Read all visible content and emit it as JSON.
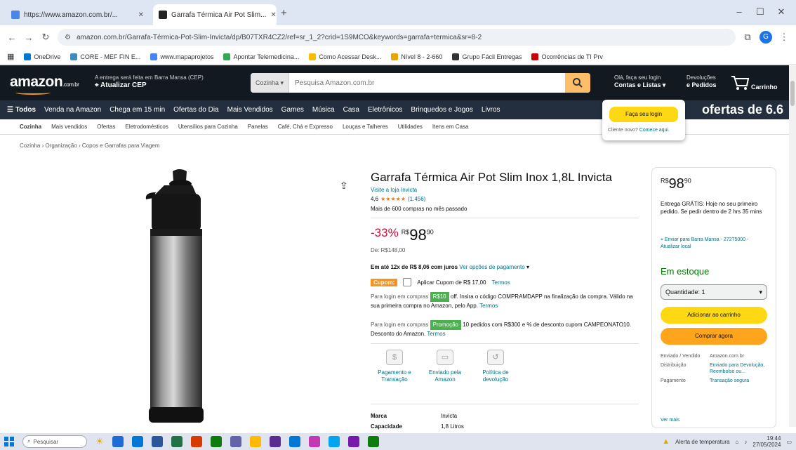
{
  "browser": {
    "tabs": [
      {
        "title": "https://www.amazon.com.br/...",
        "fav": "#4a86e8"
      },
      {
        "title": "Garrafa Térmica Air Pot Slim...",
        "fav": "#222"
      }
    ],
    "new_tab": "+",
    "url": "amazon.com.br/Garrafa-Térmica-Pot-Slim-Invicta/dp/B07TXR4CZ2/ref=sr_1_2?crid=1S9MCO&keywords=garrafa+termica&sr=8-2",
    "bookmarks": [
      {
        "label": "OneDrive",
        "color": "#0078d4"
      },
      {
        "label": "CORE - MEF FIN E...",
        "color": "#3c8dbc"
      },
      {
        "label": "www.mapaprojetos",
        "color": "#4285f4"
      },
      {
        "label": "Apontar Telemedicina...",
        "color": "#34a853"
      },
      {
        "label": "Como Acessar Desk...",
        "color": "#fbbc04"
      },
      {
        "label": "Nível 8 - 2-660",
        "color": "#e6a700"
      },
      {
        "label": "Grupo Fácil Entregas",
        "color": "#333"
      },
      {
        "label": "Ocorrências de TI Prv",
        "color": "#cc0000"
      }
    ]
  },
  "amazon": {
    "logo": "amazon",
    "logo_suffix": ".com.br",
    "location_line1": "A entrega será feita em Barra Mansa (CEP)",
    "location_line2": "Atualizar CEP",
    "search_category": "Cozinha",
    "search_placeholder": "Pesquisa Amazon.com.br",
    "account_line1": "Olá, faça seu login",
    "account_line2": "Contas e Listas",
    "orders_line1": "Devoluções",
    "orders_line2": "e Pedidos",
    "cart_label": "Carrinho",
    "nav": [
      "Todos",
      "Venda na Amazon",
      "Chega em 15 min",
      "Ofertas do Dia",
      "Mais Vendidos",
      "Games",
      "Música",
      "Casa",
      "Eletrônicos",
      "Brinquedos e Jogos",
      "Livros"
    ],
    "promo": "ofertas de 6.6",
    "subnav": [
      "Cozinha",
      "Mais vendidos",
      "Ofertas",
      "Eletrodomésticos",
      "Utensílios para Cozinha",
      "Panelas",
      "Café, Chá e Expresso",
      "Louças e Talheres",
      "Utilidades",
      "Itens em Casa"
    ],
    "breadcrumb": "Cozinha › Organização › Copos e Garrafas para Viagem",
    "popup": {
      "button": "Faça seu login",
      "new_customer": "Cliente novo?",
      "start_here": "Comece aqui."
    }
  },
  "product": {
    "title": "Garrafa Térmica Air Pot Slim Inox 1,8L Invicta",
    "store": "Visite a loja Invicta",
    "rating": "4,6",
    "stars": "★★★★★",
    "reviews": "(1.456)",
    "bought": "Mais de 600 compras no mês passado",
    "discount": "-33%",
    "price_currency": "R$",
    "price_int": "98",
    "price_cents": "90",
    "list_price": "De: R$148,00",
    "installments": "Em até 12x de R$ 8,06 com juros",
    "installments_link": "Ver opções de pagamento",
    "coupon_tag": "Cupom:",
    "coupon_text": "Aplicar Cupom de R$ 17,00",
    "coupon_terms": "Termos",
    "offer1_prefix": "Para login em compras",
    "offer1_tag": "R$10",
    "offer1_text": "off. Insira o código COMPRAMDAPP na finalização da compra. Válido na sua primeira compra no Amazon, pelo App.",
    "offer1_terms": "Termos",
    "offer2_prefix": "Para login em compras",
    "offer2_tag": "Promoção",
    "offer2_text": "10 pedidos com R$300 e % de desconto cupom CAMPEONATO10. Desconto do Amazon.",
    "offer2_terms": "Termos",
    "features": [
      {
        "icon": "$",
        "label": "Pagamento e Transação"
      },
      {
        "icon": "▭",
        "label": "Enviado pela Amazon"
      },
      {
        "icon": "↺",
        "label": "Política de devolução"
      }
    ],
    "specs": [
      {
        "key": "Marca",
        "value": "Invicta"
      },
      {
        "key": "Capacidade",
        "value": "1,8 Litros"
      }
    ]
  },
  "buybox": {
    "currency": "R$",
    "price_int": "98",
    "price_cents": "90",
    "delivery": "Entrega GRÁTIS: Hoje no seu primeiro pedido. Se pedir dentro de 2 hrs 35 mins",
    "location": "Enviar para Barra Mansa - 27275000 - Atualizar local",
    "stock": "Em estoque",
    "qty_label": "Quantidade: 1",
    "add_cart": "Adicionar ao carrinho",
    "buy_now": "Comprar agora",
    "seller_label1": "Enviado / Vendido",
    "seller_value1": "Amazon.com.br",
    "seller_label2": "Distribuição",
    "seller_value2": "Enviado para Devolução, Reembolso ou...",
    "payment_label": "Pagamento",
    "payment_value": "Transação segura",
    "see_more": "Ver mais"
  },
  "taskbar": {
    "search_placeholder": "Pesquisar",
    "weather": "Alerta de temperatura",
    "time": "19:44",
    "date": "27/05/2024",
    "apps": [
      "#1e6bd6",
      "#0078d4",
      "#2b579a",
      "#217346",
      "#d83b01",
      "#0f7b0f",
      "#6264a7",
      "#ffb900",
      "#5c2d91",
      "#0078d4",
      "#c239b3",
      "#00a4ef",
      "#7719aa",
      "#107c10"
    ]
  }
}
